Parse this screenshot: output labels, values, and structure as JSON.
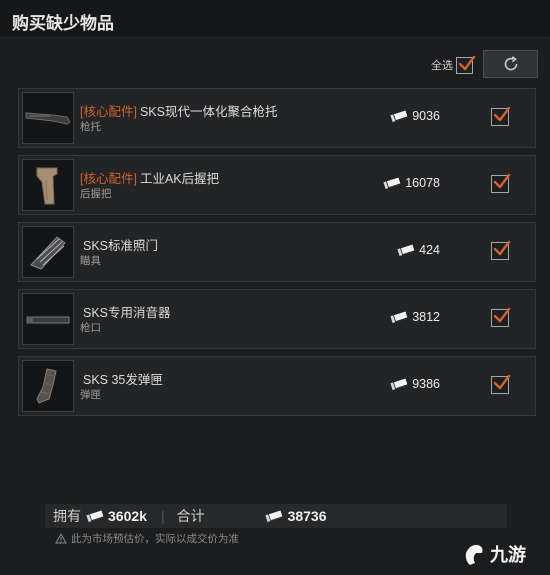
{
  "header": {
    "title": "购买缺少物品"
  },
  "toolbar": {
    "select_all_label": "全选",
    "select_all_checked": true
  },
  "items": [
    {
      "tag": "[核心配件]",
      "name": "SKS现代一体化聚合枪托",
      "category": "枪托",
      "price": "9036",
      "checked": true,
      "icon": "stock-icon"
    },
    {
      "tag": "[核心配件]",
      "name": "工业AK后握把",
      "category": "后握把",
      "price": "16078",
      "checked": true,
      "icon": "grip-icon"
    },
    {
      "tag": "",
      "name": "SKS标准照门",
      "category": "瞄具",
      "price": "424",
      "checked": true,
      "icon": "sight-icon"
    },
    {
      "tag": "",
      "name": "SKS专用消音器",
      "category": "枪口",
      "price": "3812",
      "checked": true,
      "icon": "suppressor-icon"
    },
    {
      "tag": "",
      "name": "SKS 35发弹匣",
      "category": "弹匣",
      "price": "9386",
      "checked": true,
      "icon": "magazine-icon"
    }
  ],
  "footer": {
    "owned_label": "拥有",
    "owned_value": "3602k",
    "separator": "|",
    "total_label": "合计",
    "total_value": "38736",
    "note": "此为市场预估价，实际以成交价为准"
  },
  "watermark": {
    "text": "九游"
  },
  "colors": {
    "accent": "#d0632e",
    "background": "#1c1d1f",
    "panel": "#232426"
  }
}
